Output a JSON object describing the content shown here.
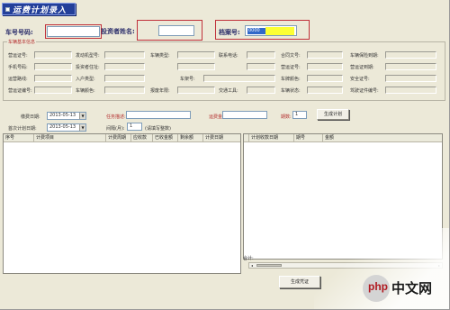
{
  "app": {
    "title": "运费计划录入"
  },
  "header": {
    "car_no_label": "车号号码:",
    "car_no_value": "",
    "investor_label": "投资者姓名:",
    "investor_value": "",
    "archive_label": "档案号:",
    "archive_value": "0000"
  },
  "vehicle_group": {
    "title": "车辆基本信息",
    "fields": [
      {
        "label": "营运证号:",
        "value": ""
      },
      {
        "label": "发动机型号:",
        "value": ""
      },
      {
        "label": "车辆类型:",
        "value": ""
      },
      {
        "label": "联系电话:",
        "value": ""
      },
      {
        "label": "合同文号:",
        "value": ""
      },
      {
        "label": "车辆保险到期:",
        "value": ""
      },
      {
        "label": "手机号码:",
        "value": ""
      },
      {
        "label": "投资者住址:",
        "value": ""
      },
      {
        "label": "",
        "value": ""
      },
      {
        "label": "",
        "value": ""
      },
      {
        "label": "营运证号:",
        "value": ""
      },
      {
        "label": "营运证到期:",
        "value": ""
      },
      {
        "label": "运营路线:",
        "value": ""
      },
      {
        "label": "入户类型:",
        "value": ""
      },
      {
        "label": "车架号:",
        "value": ""
      },
      {
        "label": "",
        "value": ""
      },
      {
        "label": "车牌颜色:",
        "value": ""
      },
      {
        "label": "安全证号:",
        "value": ""
      },
      {
        "label": "营运证编号:",
        "value": ""
      },
      {
        "label": "车辆颜色:",
        "value": ""
      },
      {
        "label": "报废年限:",
        "value": ""
      },
      {
        "label": "交通工具:",
        "value": ""
      },
      {
        "label": "车辆状态:",
        "value": ""
      },
      {
        "label": "驾驶证件编号:",
        "value": ""
      }
    ]
  },
  "controls": {
    "date_label": "缴费日期:",
    "date_value": "2013-05-13",
    "task_label": "任务描述:",
    "task_value": "",
    "amount_label": "运费金额:",
    "amount_value": "",
    "period_label": "期数:",
    "period_value": "1",
    "gen_button": "生成计划",
    "start_label": "首次计划日期:",
    "start_value": "2013-05-13",
    "interval_label": "间隔(月):",
    "interval_value": "1",
    "interval_hint": "(请填写整数)"
  },
  "left_grid": {
    "columns": [
      "序号",
      "计费项目",
      "计费周期",
      "应收款",
      "已收金额",
      "剩余额",
      "计费日期"
    ]
  },
  "right_grid": {
    "columns": [
      "计划收款日期",
      "期号",
      "金额"
    ],
    "total_label": "合计:"
  },
  "footer": {
    "generate_button": "生成凭证"
  },
  "watermark": {
    "logo": "php",
    "site": "中文网"
  }
}
